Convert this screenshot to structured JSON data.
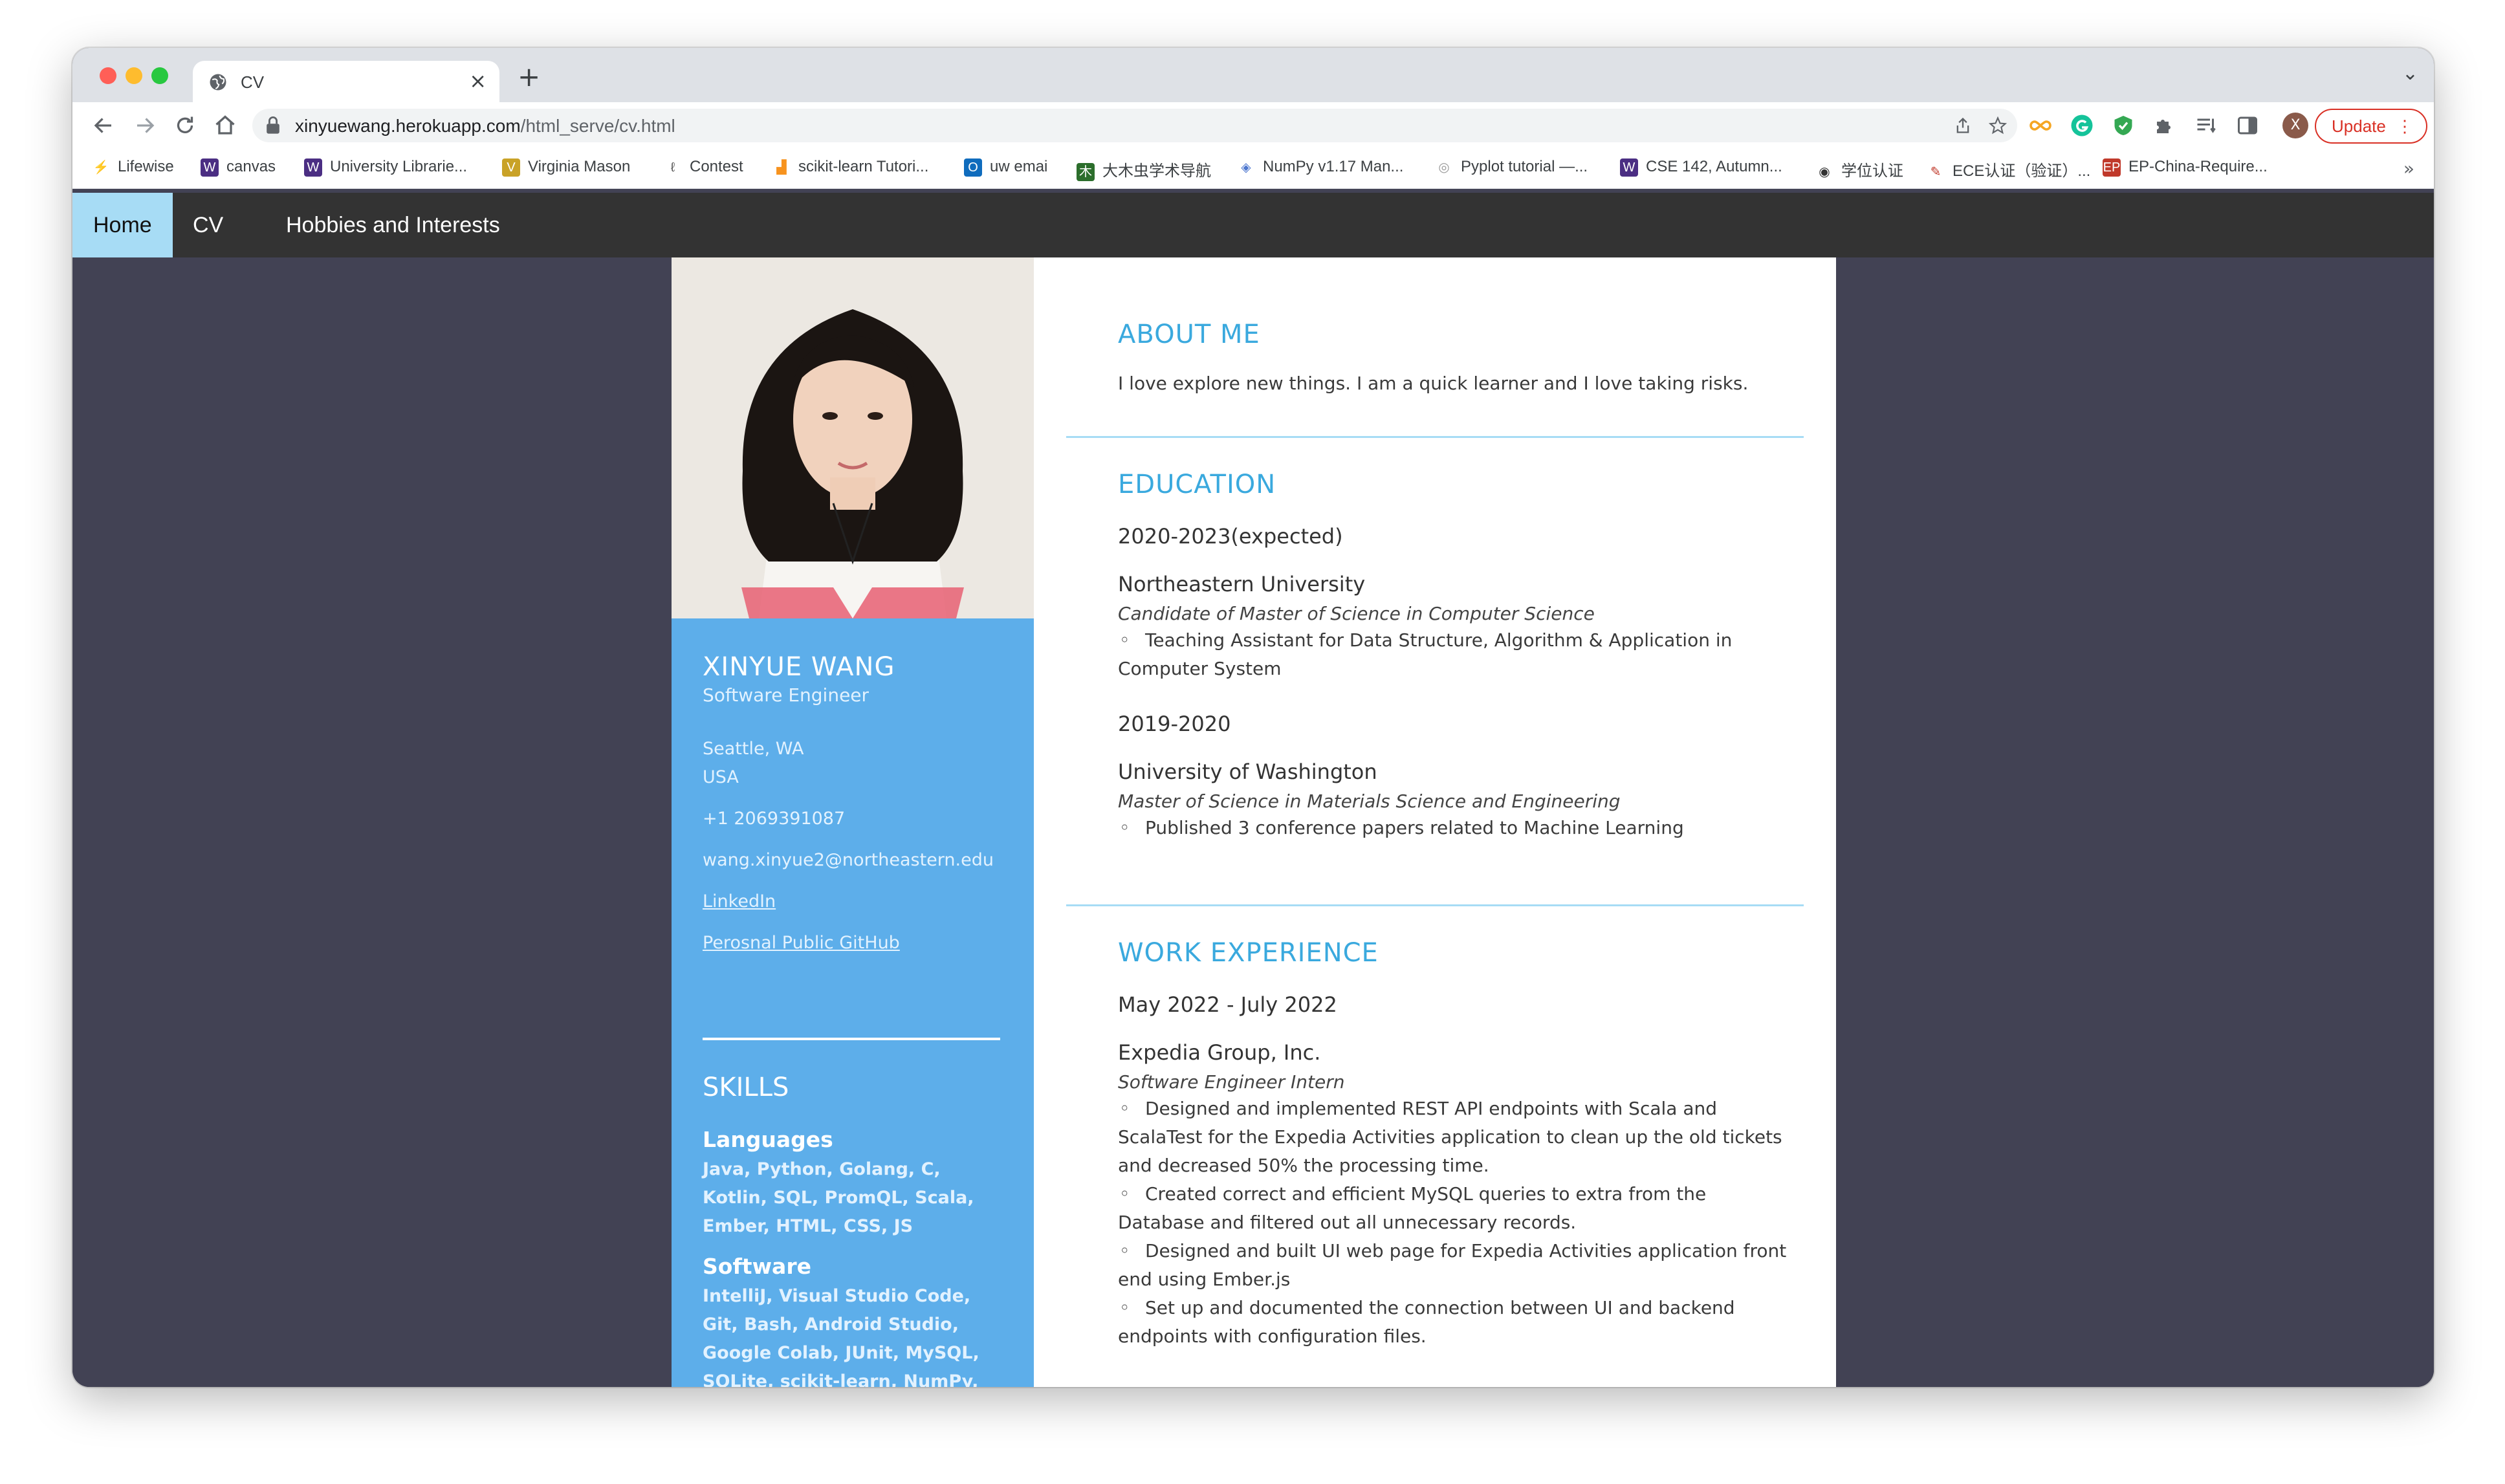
{
  "browser": {
    "tab_title": "CV",
    "tab_close": "×",
    "new_tab": "+",
    "tabs_dropdown": "⌄",
    "url_host": "xinyuewang.herokuapp.com",
    "url_path": "/html_serve/cv.html",
    "profile_initial": "X",
    "update_label": "Update",
    "update_menu": "⋮",
    "bookmarks_more": "»",
    "bookmarks": [
      {
        "label": "Lifewise",
        "icon": "lifewise-icon",
        "color": "#2bb673"
      },
      {
        "label": "canvas",
        "icon": "canvas-icon",
        "color": "#4b2e83"
      },
      {
        "label": "University Librarie...",
        "icon": "uw-icon",
        "color": "#4b2e83"
      },
      {
        "label": "Virginia Mason",
        "icon": "virginia-mason-icon",
        "color": "#c9a227"
      },
      {
        "label": "Contest",
        "icon": "contest-icon",
        "color": "#555555"
      },
      {
        "label": "scikit-learn Tutori...",
        "icon": "chart-icon",
        "color": "#f7931e"
      },
      {
        "label": "uw emai",
        "icon": "outlook-icon",
        "color": "#0f6cbd"
      },
      {
        "label": "大木虫学术导航",
        "icon": "damuchong-icon",
        "color": "#2c6e2c"
      },
      {
        "label": "NumPy v1.17 Man...",
        "icon": "numpy-icon",
        "color": "#4d77cf"
      },
      {
        "label": "Pyplot tutorial —...",
        "icon": "matplotlib-icon",
        "color": "#999999"
      },
      {
        "label": "CSE 142, Autumn...",
        "icon": "uw-icon",
        "color": "#4b2e83"
      },
      {
        "label": "学位认证",
        "icon": "globe-icon",
        "color": "#333333"
      },
      {
        "label": "ECE认证（验证）...",
        "icon": "ece-icon",
        "color": "#c0392b"
      },
      {
        "label": "EP-China-Require...",
        "icon": "ep-icon",
        "color": "#c0392b"
      }
    ]
  },
  "nav": {
    "items": [
      "Home",
      "CV",
      "Hobbies and Interests"
    ],
    "active": "Home"
  },
  "profile": {
    "name": "XINYUE WANG",
    "title": "Software Engineer",
    "city": "Seattle, WA",
    "country": "USA",
    "phone": "+1 2069391087",
    "email": "wang.xinyue2@northeastern.edu",
    "linkedin": "LinkedIn",
    "github": "Perosnal Public GitHub"
  },
  "skills": {
    "heading": "SKILLS",
    "languages_label": "Languages",
    "languages": "Java, Python, Golang, C, Kotlin, SQL, PromQL, Scala, Ember, HTML, CSS, JS",
    "software_label": "Software",
    "software": "IntelliJ, Visual Studio Code, Git, Bash, Android Studio, Google Colab, JUnit, MySQL, SQLite, scikit-learn, NumPy, TensorFlow, Keras, Wireshark, Prometheus, Grafana"
  },
  "about": {
    "heading": "ABOUT ME",
    "text": "I love explore new things. I am a quick learner and I love taking risks."
  },
  "education": {
    "heading": "EDUCATION",
    "entries": [
      {
        "date": "2020-2023(expected)",
        "org": "Northeastern University",
        "role": "Candidate of Master of Science in Computer Science",
        "bullets": [
          "Teaching Assistant for Data Structure, Algorithm & Application in Computer System"
        ]
      },
      {
        "date": "2019-2020",
        "org": "University of Washington",
        "role": "Master of Science in Materials Science and Engineering",
        "bullets": [
          "Published 3 conference papers related to Machine Learning"
        ]
      }
    ]
  },
  "work": {
    "heading": "WORK EXPERIENCE",
    "entries": [
      {
        "date": "May 2022 - July 2022",
        "org": "Expedia Group, Inc.",
        "role": "Software Engineer Intern",
        "bullets": [
          "Designed and implemented REST API endpoints with Scala and ScalaTest for the Expedia Activities application to clean up the old tickets and decreased 50% the processing time.",
          "Created correct and efficient MySQL queries to extra from the Database and filtered out all unnecessary records.",
          "Designed and built UI web page for Expedia Activities application front end using Ember.js",
          "Set up and documented the connection between UI and backend endpoints with configuration files."
        ]
      }
    ]
  },
  "colors": {
    "nav_bg": "#333333",
    "nav_active": "#a7dcf5",
    "page_bg": "#424254",
    "sidebar": "#5daeea",
    "accent": "#3aa9de"
  }
}
